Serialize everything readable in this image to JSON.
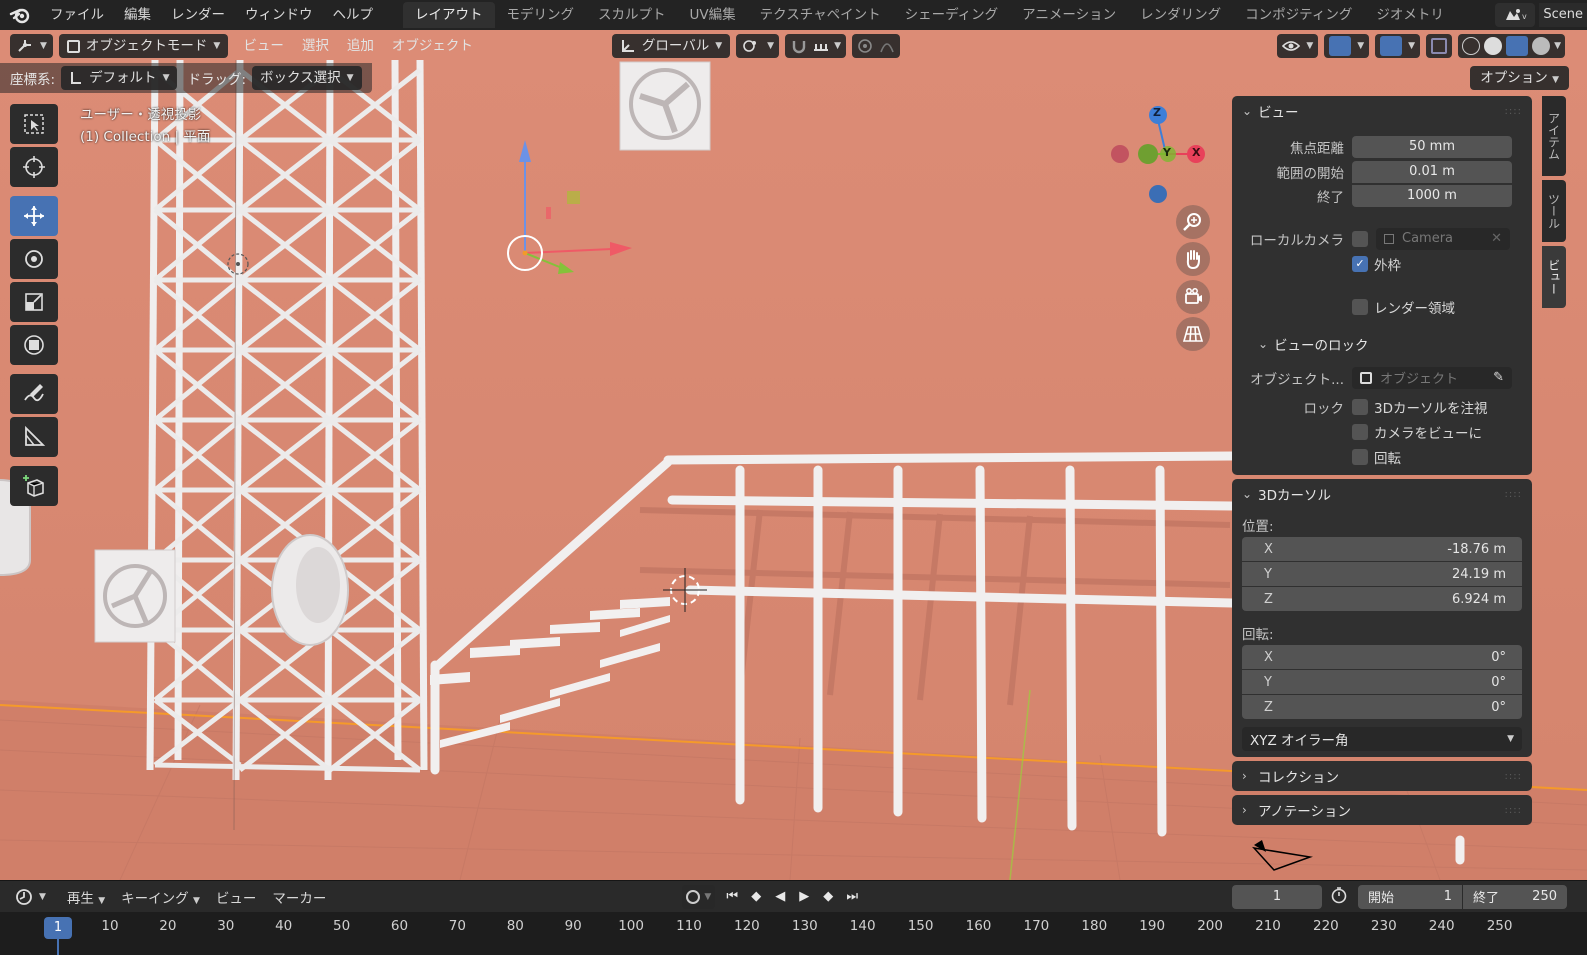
{
  "menu": [
    "ファイル",
    "編集",
    "レンダー",
    "ウィンドウ",
    "ヘルプ"
  ],
  "workspaces": [
    "レイアウト",
    "モデリング",
    "スカルプト",
    "UV編集",
    "テクスチャペイント",
    "シェーディング",
    "アニメーション",
    "レンダリング",
    "コンポジティング",
    "ジオメトリ"
  ],
  "active_workspace": "レイアウト",
  "scene_name": "Scene",
  "header": {
    "mode": "オブジェクトモード",
    "view": "ビュー",
    "select": "選択",
    "add": "追加",
    "object": "オブジェクト",
    "orientation": "グローバル"
  },
  "header2": {
    "coord_label": "座標系:",
    "coord_value": "デフォルト",
    "drag_label": "ドラッグ:",
    "drag_value": "ボックス選択",
    "options": "オプション"
  },
  "viewport": {
    "projection": "ユーザー・透視投影",
    "collection": "(1) Collection | 平面",
    "background_color": "#d98a74"
  },
  "gizmo_labels": {
    "z": "Z",
    "y": "Y",
    "x": "X"
  },
  "npanel": {
    "view": {
      "title": "ビュー",
      "focal_label": "焦点距離",
      "focal_value": "50 mm",
      "clip_start_label": "範囲の開始",
      "clip_start_value": "0.01 m",
      "clip_end_label": "終了",
      "clip_end_value": "1000 m",
      "local_camera_label": "ローカルカメラ",
      "camera_name": "Camera",
      "border_label": "外枠",
      "render_region_label": "レンダー領域"
    },
    "view_lock": {
      "title": "ビューのロック",
      "object_label": "オブジェクト...",
      "object_placeholder": "オブジェクト",
      "lock_label": "ロック",
      "lock_cursor": "3Dカーソルを注視",
      "lock_camera": "カメラをビューに",
      "lock_rotation": "回転"
    },
    "cursor": {
      "title": "3Dカーソル",
      "location_label": "位置:",
      "x": "-18.76 m",
      "y": "24.19 m",
      "z": "6.924 m",
      "rotation_label": "回転:",
      "rx": "0°",
      "ry": "0°",
      "rz": "0°",
      "mode": "XYZ オイラー角"
    },
    "collection_title": "コレクション",
    "annotation_title": "アノテーション",
    "axis": {
      "x": "X",
      "y": "Y",
      "z": "Z"
    }
  },
  "side_tabs": [
    "アイテム",
    "ツール",
    "ビュー"
  ],
  "timeline": {
    "playback": "再生",
    "keying": "キーイング",
    "view": "ビュー",
    "marker": "マーカー",
    "current_frame": "1",
    "start_label": "開始",
    "start_value": "1",
    "end_label": "終了",
    "end_value": "250"
  },
  "ruler": {
    "current": "1",
    "ticks": [
      "10",
      "20",
      "30",
      "40",
      "50",
      "60",
      "70",
      "80",
      "90",
      "100",
      "110",
      "120",
      "130",
      "140",
      "150",
      "160",
      "170",
      "180",
      "190",
      "200",
      "210",
      "220",
      "230",
      "240",
      "250"
    ]
  },
  "colors": {
    "accent": "#4772b3",
    "panel": "#303030",
    "field": "#545454",
    "axis_x": "#e8415a",
    "axis_y": "#7cb82f",
    "axis_z": "#3d7fd8"
  }
}
